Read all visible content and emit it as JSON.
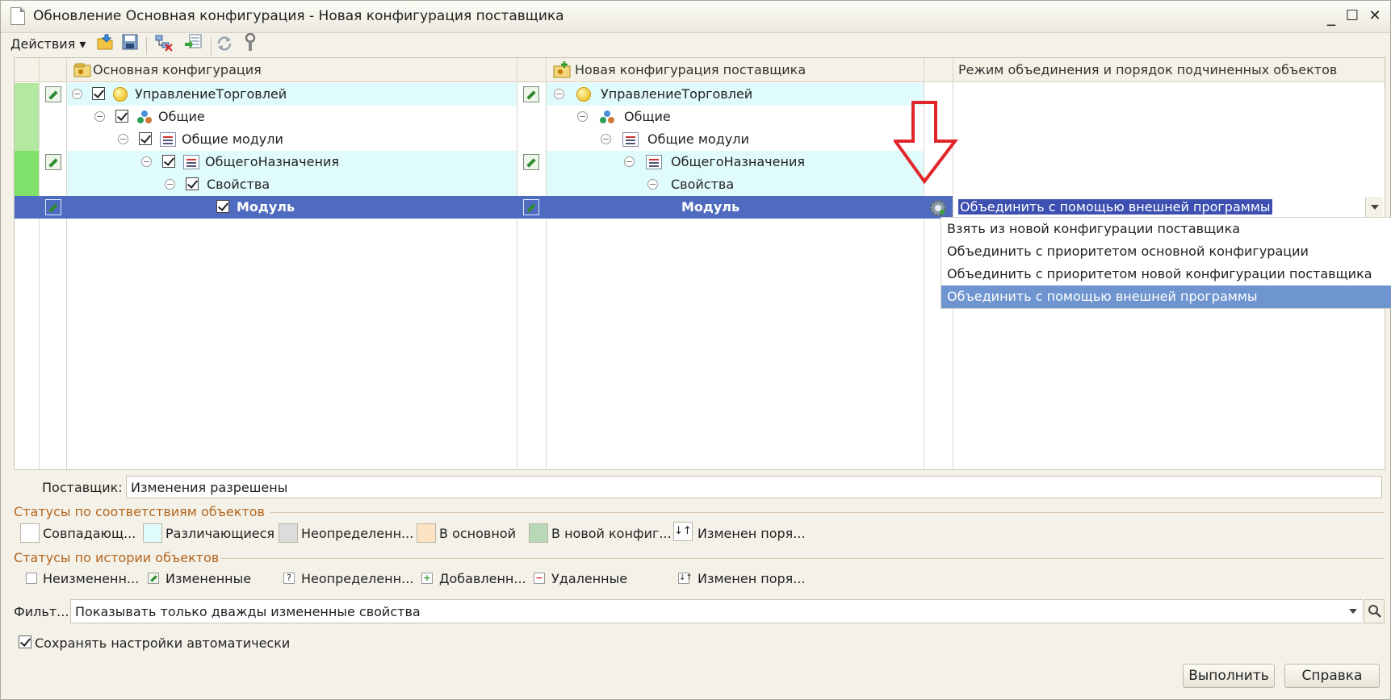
{
  "window": {
    "title": "Обновление Основная конфигурация - Новая конфигурация поставщика",
    "minimize": "_",
    "maximize": "☐",
    "close": "✕"
  },
  "toolbar": {
    "actions_label": "Действия ▾"
  },
  "grid": {
    "headers": {
      "main": "Основная конфигурация",
      "vendor": "Новая конфигурация поставщика",
      "mode": "Режим объединения и порядок подчиненных объектов"
    },
    "rows": [
      {
        "main": "УправлениеТорговлей",
        "vendor": "УправлениеТорговлей"
      },
      {
        "main": "Общие",
        "vendor": "Общие"
      },
      {
        "main": "Общие модули",
        "vendor": "Общие модули"
      },
      {
        "main": "ОбщегоНазначения",
        "vendor": "ОбщегоНазначения"
      },
      {
        "main": "Свойства",
        "vendor": "Свойства"
      },
      {
        "main": "Модуль",
        "vendor": "Модуль",
        "mode": "Объединить с помощью внешней программы"
      }
    ],
    "mode_options": [
      "Взять из новой конфигурации поставщика",
      "Объединить с приоритетом основной конфигурации",
      "Объединить с приоритетом новой конфигурации поставщика",
      "Объединить с помощью внешней программы"
    ]
  },
  "vendor_field": {
    "label": "Поставщик:",
    "value": "Изменения разрешены"
  },
  "status_match": {
    "title": "Статусы по соответствиям объектов",
    "items": [
      {
        "label": "Совпадающ...",
        "color": "#ffffff"
      },
      {
        "label": "Различающиеся",
        "color": "#e0fbfb"
      },
      {
        "label": "Неопределенн...",
        "color": "#dcdcdc"
      },
      {
        "label": "В основной",
        "color": "#fde3c4"
      },
      {
        "label": "В новой конфиг...",
        "color": "#b8d8b8"
      },
      {
        "label": "Изменен поря...",
        "color": "#ffffff"
      }
    ]
  },
  "status_history": {
    "title": "Статусы по истории объектов",
    "items": [
      {
        "label": "Неизмененн..."
      },
      {
        "label": "Измененные"
      },
      {
        "label": "Неопределенн..."
      },
      {
        "label": "Добавленн..."
      },
      {
        "label": "Удаленные"
      },
      {
        "label": "Изменен поря..."
      }
    ]
  },
  "filter": {
    "label": "Фильт...",
    "value": "Показывать только дважды измененные свойства"
  },
  "autosave": {
    "label": "Сохранять настройки автоматически"
  },
  "buttons": {
    "run": "Выполнить",
    "help": "Справка"
  },
  "colors": {
    "selected_row": "#4f6bbf",
    "diff_row": "#e0fbfb",
    "status_green": "#b2e8a0",
    "status_green_dark": "#7fe06a",
    "arrow": "#e0262b"
  }
}
